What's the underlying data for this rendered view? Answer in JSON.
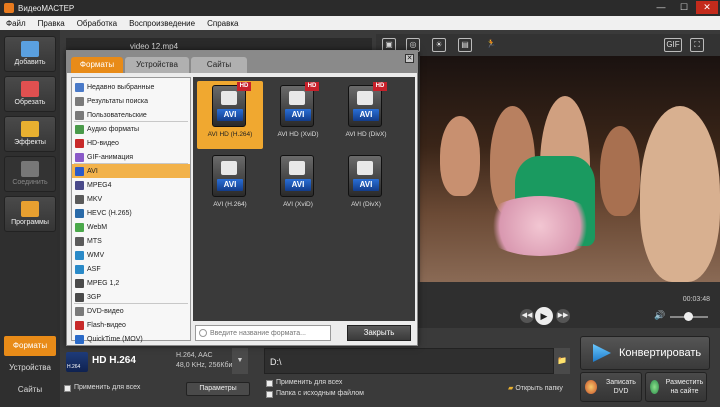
{
  "window": {
    "title": "ВидеоМАСТЕР",
    "min": "—",
    "max": "☐",
    "close": "✕"
  },
  "menu": [
    "Файл",
    "Правка",
    "Обработка",
    "Воспроизведение",
    "Справка"
  ],
  "leftbar": {
    "buttons": [
      {
        "label": "Добавить",
        "icon": "add-video-icon",
        "color": "#5aa0e0"
      },
      {
        "label": "Обрезать",
        "icon": "cut-icon",
        "color": "#e05050"
      },
      {
        "label": "Эффекты",
        "icon": "effects-icon",
        "color": "#e8b030"
      },
      {
        "label": "Соединить",
        "icon": "join-icon",
        "color": "#777777"
      },
      {
        "label": "Программы",
        "icon": "programs-icon",
        "color": "#e8a030"
      }
    ],
    "tabs": [
      "Форматы",
      "Устройства",
      "Сайты"
    ]
  },
  "file_strip": {
    "filename": "video 12.mp4"
  },
  "player": {
    "time": "00:03:48",
    "toolbar_icons": [
      "crop-icon",
      "rotate-icon",
      "brightness-icon",
      "film-icon",
      "run-icon"
    ],
    "gif": "GIF"
  },
  "output": {
    "format_name": "HD H.264",
    "format_icon_text": "H.264",
    "spec_line1": "H.264, AAC",
    "spec_line2": "48,0 KHz, 256Кбит",
    "apply_all": "Применить для всех",
    "params": "Параметры",
    "path": "D:\\",
    "apply_all_right": "Применить для всех",
    "source_folder": "Папка с исходным файлом",
    "open_folder": "Открыть папку"
  },
  "actions": {
    "convert": "Конвертировать",
    "dvd": "Записать DVD",
    "publish": "Разместить на сайте"
  },
  "dialog": {
    "tabs": [
      "Форматы",
      "Устройства",
      "Сайты"
    ],
    "list": [
      {
        "label": "Недавно выбранные",
        "color": "#4a7ac8"
      },
      {
        "label": "Результаты поиска",
        "color": "#7a7a7a"
      },
      {
        "label": "Пользовательские",
        "color": "#7a7a7a"
      },
      {
        "label": "Аудио форматы",
        "color": "#4a9a4a"
      },
      {
        "label": "HD-видео",
        "color": "#c82a2a"
      },
      {
        "label": "GIF-анимация",
        "color": "#8a5ac8"
      },
      {
        "label": "AVI",
        "color": "#2a5ac8"
      },
      {
        "label": "MPEG4",
        "color": "#4a4a8a"
      },
      {
        "label": "MKV",
        "color": "#5a5a5a"
      },
      {
        "label": "HEVC (H.265)",
        "color": "#2a6aa8"
      },
      {
        "label": "WebM",
        "color": "#4aa84a"
      },
      {
        "label": "MTS",
        "color": "#5a5a5a"
      },
      {
        "label": "WMV",
        "color": "#2a8ac8"
      },
      {
        "label": "ASF",
        "color": "#2a8ac8"
      },
      {
        "label": "MPEG 1,2",
        "color": "#4a4a4a"
      },
      {
        "label": "3GP",
        "color": "#4a4a4a"
      },
      {
        "label": "DVD-видео",
        "color": "#7a7a7a"
      },
      {
        "label": "Flash-видео",
        "color": "#c82a2a"
      },
      {
        "label": "QuickTime (MOV)",
        "color": "#2a6ac8"
      }
    ],
    "selected_list_item": "AVI",
    "grid": [
      {
        "caption": "AVI HD (H.264)",
        "hd": true,
        "selected": true
      },
      {
        "caption": "AVI HD (XviD)",
        "hd": true,
        "selected": false
      },
      {
        "caption": "AVI HD (DivX)",
        "hd": true,
        "selected": false
      },
      {
        "caption": "AVI (H.264)",
        "hd": false,
        "selected": false
      },
      {
        "caption": "AVI (XviD)",
        "hd": false,
        "selected": false
      },
      {
        "caption": "AVI (DivX)",
        "hd": false,
        "selected": false
      }
    ],
    "icon_text": "AVI",
    "hd_text": "HD",
    "search_placeholder": "Введите название формата...",
    "close": "Закрыть"
  }
}
